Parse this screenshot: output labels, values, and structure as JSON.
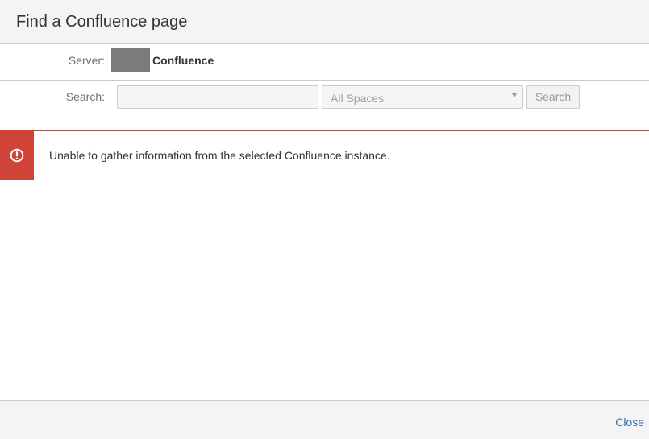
{
  "dialog": {
    "title": "Find a Confluence page"
  },
  "server": {
    "label": "Server:",
    "name": "Confluence"
  },
  "search": {
    "label": "Search:",
    "value": "",
    "placeholder": "",
    "space_selected": "All Spaces",
    "button_label": "Search"
  },
  "error": {
    "icon": "exclamation-circle-icon",
    "message": "Unable to gather information from the selected Confluence instance."
  },
  "footer": {
    "close_label": "Close"
  },
  "colors": {
    "error": "#d04437",
    "link": "#3572b0",
    "header_bg": "#f4f4f4"
  }
}
